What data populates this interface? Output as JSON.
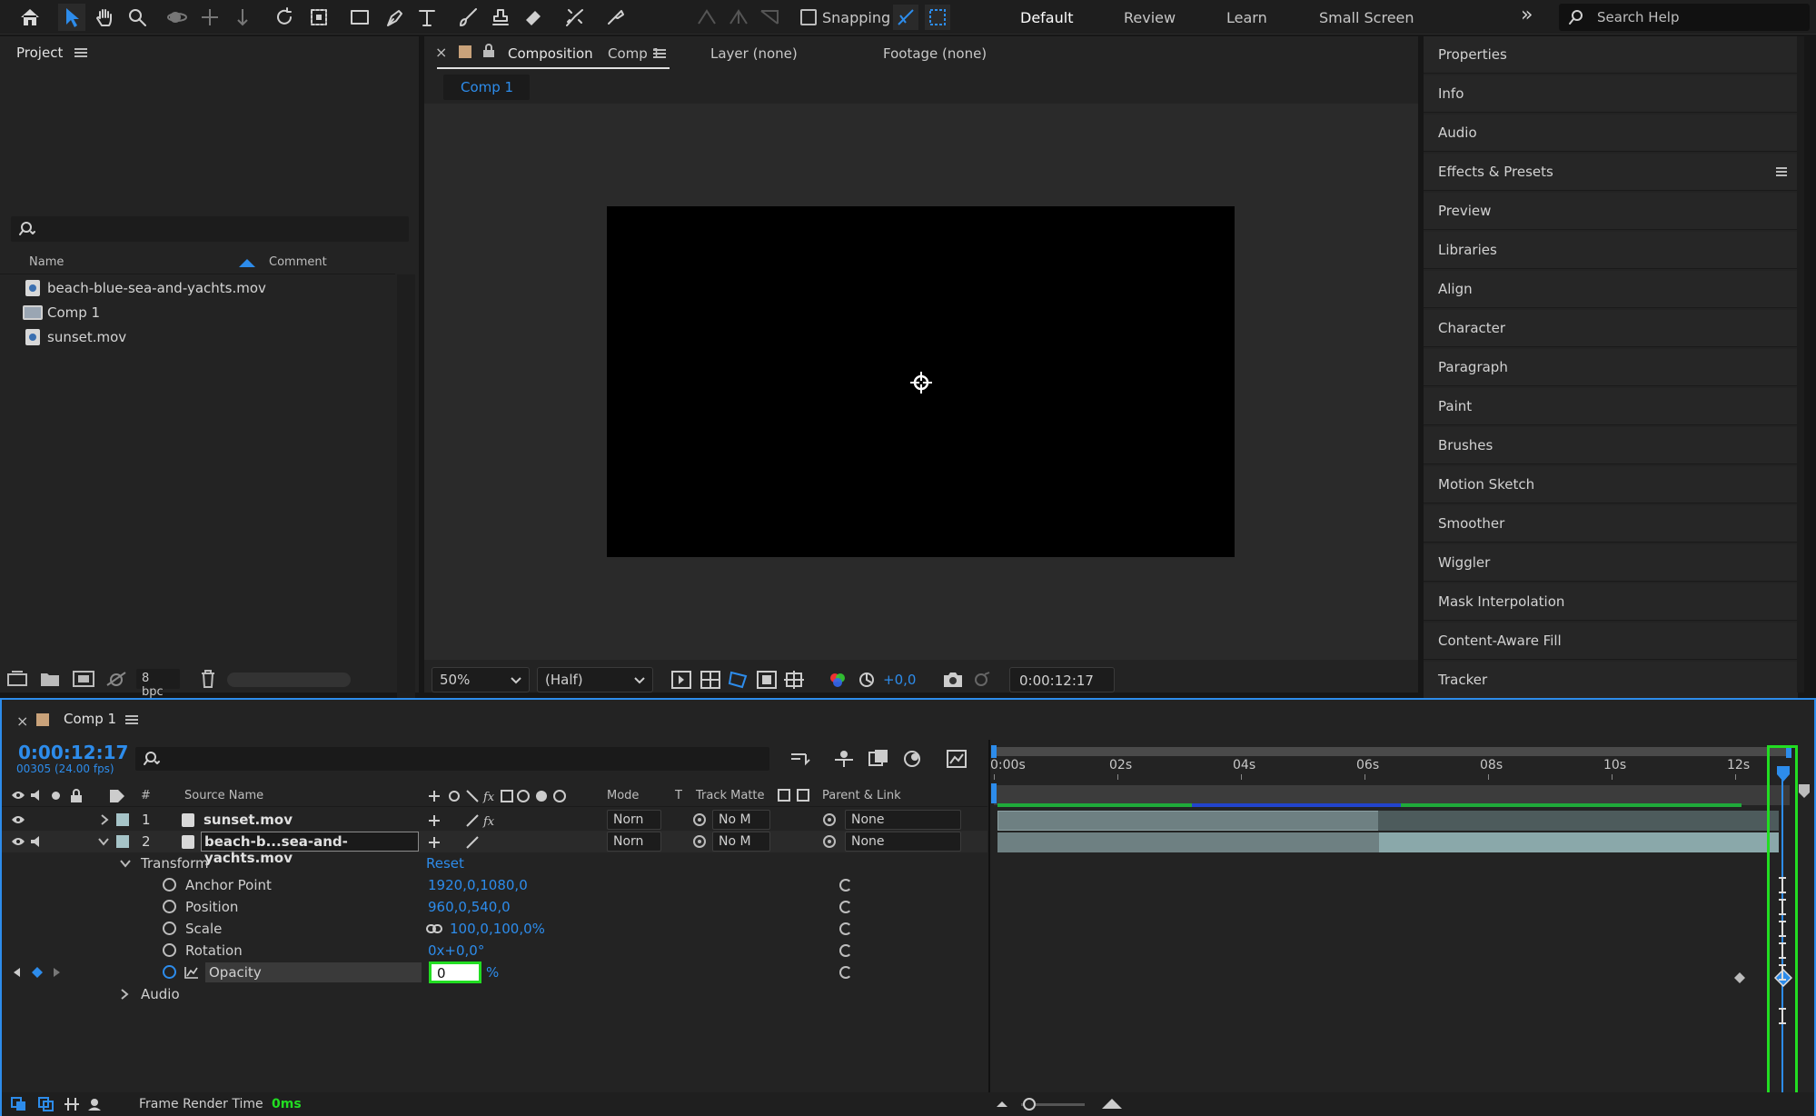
{
  "toolbar": {
    "tools": [
      "home-icon",
      "selection-icon",
      "hand-icon",
      "zoom-icon",
      "orbit-icon",
      "pan-behind-icon",
      "dolly-icon",
      "rotate-icon",
      "region-icon",
      "rectangle-icon",
      "pen-icon",
      "type-icon",
      "brush-icon",
      "clone-stamp-icon",
      "eraser-icon",
      "roto-brush-icon",
      "puppet-icon"
    ],
    "snapping_label": "Snapping",
    "workspaces": [
      "Default",
      "Review",
      "Learn",
      "Small Screen"
    ],
    "more": "»",
    "search_placeholder": "Search Help"
  },
  "project": {
    "title": "Project",
    "col_name": "Name",
    "col_comment": "Comment",
    "items": [
      {
        "name": "beach-blue-sea-and-yachts.mov",
        "type": "footage"
      },
      {
        "name": "Comp 1",
        "type": "composition"
      },
      {
        "name": "sunset.mov",
        "type": "footage"
      }
    ],
    "bpc": "8 bpc"
  },
  "composition": {
    "tab_prefix": "Composition",
    "tab_name": "Comp 1",
    "layer_tab": "Layer (none)",
    "footage_tab": "Footage (none)",
    "sub_tab": "Comp 1",
    "zoom": "50%",
    "resolution": "(Half)",
    "exposure": "+0,0",
    "timecode": "0:00:12:17"
  },
  "right_panels": [
    "Properties",
    "Info",
    "Audio",
    "Effects & Presets",
    "Preview",
    "Libraries",
    "Align",
    "Character",
    "Paragraph",
    "Paint",
    "Brushes",
    "Motion Sketch",
    "Smoother",
    "Wiggler",
    "Mask Interpolation",
    "Content-Aware Fill",
    "Tracker"
  ],
  "timeline": {
    "title": "Comp 1",
    "timecode": "0:00:12:17",
    "frame_info": "00305 (24.00 fps)",
    "columns": {
      "num": "#",
      "source": "Source Name",
      "mode": "Mode",
      "t": "T",
      "track_matte": "Track Matte",
      "parent": "Parent & Link"
    },
    "layers": [
      {
        "num": "1",
        "name": "sunset.mov",
        "mode": "Norn",
        "matte": "No M",
        "parent": "None"
      },
      {
        "num": "2",
        "name": "beach-b...sea-and-yachts.mov",
        "mode": "Norn",
        "matte": "No M",
        "parent": "None"
      }
    ],
    "transform_label": "Transform",
    "reset_label": "Reset",
    "properties": [
      {
        "name": "Anchor Point",
        "value": "1920,0,1080,0"
      },
      {
        "name": "Position",
        "value": "960,0,540,0"
      },
      {
        "name": "Scale",
        "value": "100,0,100,0%"
      },
      {
        "name": "Rotation",
        "value": "0x+0,0°"
      },
      {
        "name": "Opacity",
        "value": "0",
        "unit": "%"
      }
    ],
    "audio_label": "Audio",
    "ruler": [
      "0:00s",
      "02s",
      "04s",
      "06s",
      "08s",
      "10s",
      "12s"
    ],
    "footer_label": "Frame Render Time",
    "footer_value": "0ms"
  }
}
